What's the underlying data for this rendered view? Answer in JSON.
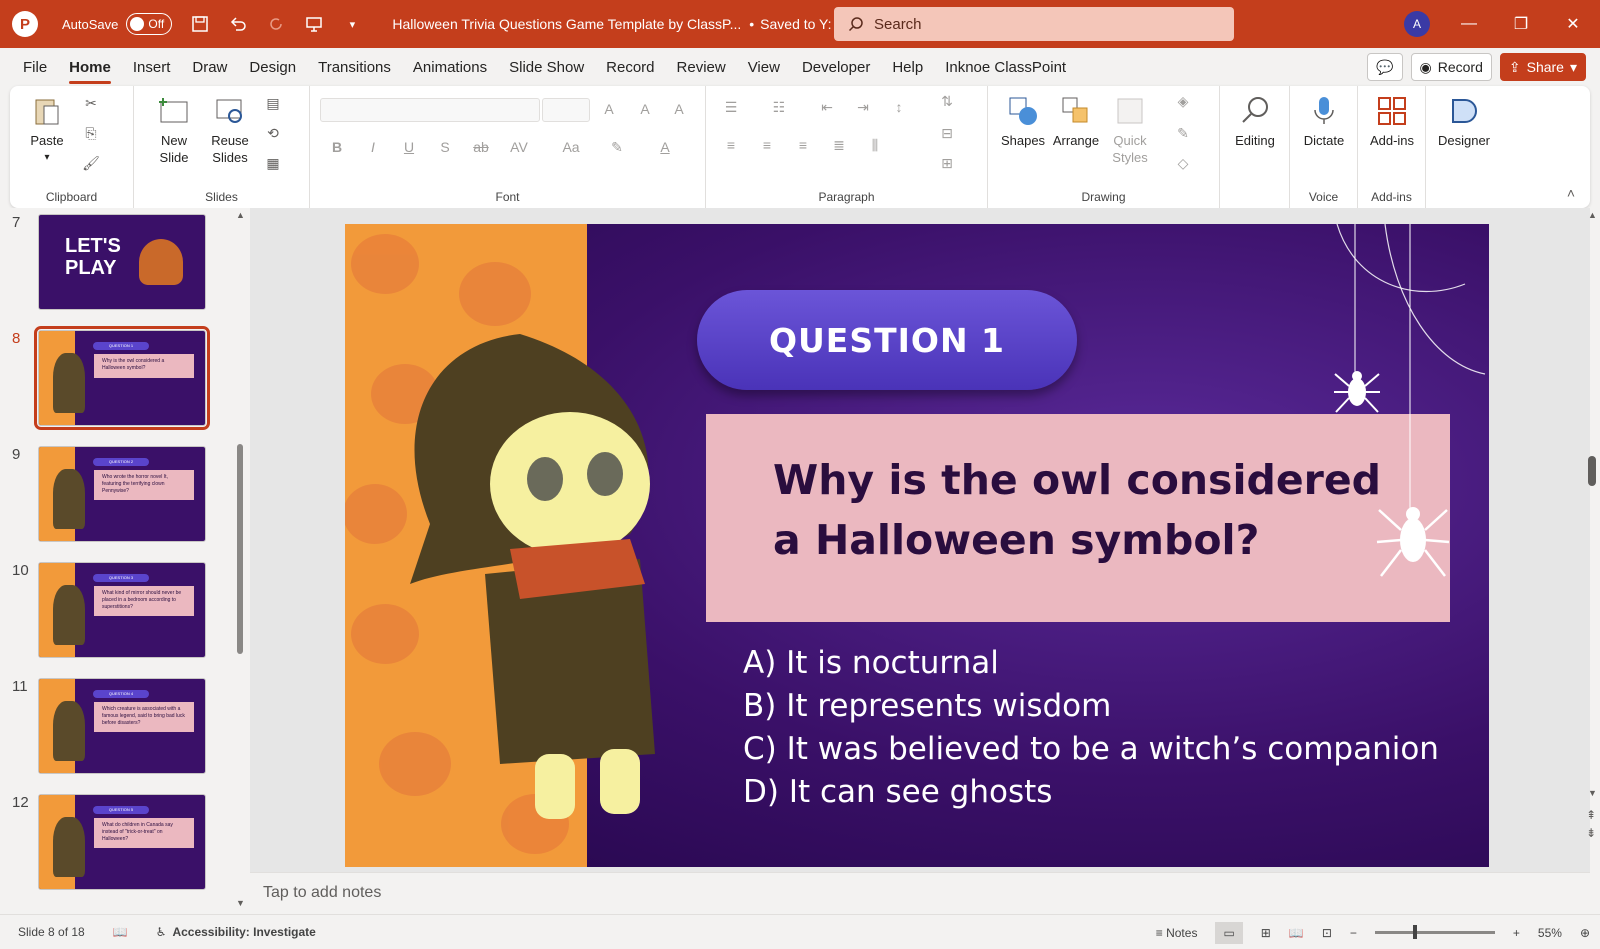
{
  "titlebar": {
    "autosave_label": "AutoSave",
    "autosave_state": "Off",
    "doc_title": "Halloween Trivia Questions Game Template by ClassP...",
    "saved_status": "Saved to Y: Drive",
    "search_placeholder": "Search",
    "avatar_initial": "A",
    "accent_color": "#c43e1c"
  },
  "menu": {
    "items": [
      "File",
      "Home",
      "Insert",
      "Draw",
      "Design",
      "Transitions",
      "Animations",
      "Slide Show",
      "Record",
      "Review",
      "View",
      "Developer",
      "Help",
      "Inknoe ClassPoint"
    ],
    "active": "Home",
    "record_label": "Record",
    "share_label": "Share"
  },
  "ribbon": {
    "clipboard": {
      "paste": "Paste",
      "label": "Clipboard"
    },
    "slides": {
      "new_slide": "New Slide",
      "reuse_slides": "Reuse Slides",
      "label": "Slides"
    },
    "font": {
      "label": "Font"
    },
    "paragraph": {
      "label": "Paragraph"
    },
    "drawing": {
      "shapes": "Shapes",
      "arrange": "Arrange",
      "quick_styles": "Quick Styles",
      "label": "Drawing"
    },
    "editing": {
      "label": "Editing"
    },
    "voice": {
      "dictate": "Dictate",
      "label": "Voice"
    },
    "addins": {
      "addins": "Add-ins",
      "label": "Add-ins"
    },
    "designer": {
      "label": "Designer"
    }
  },
  "thumbnails": [
    {
      "num": "7",
      "title": "LET'S PLAY"
    },
    {
      "num": "8",
      "question": "QUESTION 1",
      "text": "Why is the owl considered a Halloween symbol?"
    },
    {
      "num": "9",
      "question": "QUESTION 2",
      "text": "Who wrote the horror novel It, featuring the terrifying clown Pennywise?"
    },
    {
      "num": "10",
      "question": "QUESTION 3",
      "text": "What kind of mirror should never be placed in a bedroom according to superstitions?"
    },
    {
      "num": "11",
      "question": "QUESTION 4",
      "text": "Which creature is associated with a famous legend, said to bring bad luck before disasters?"
    },
    {
      "num": "12",
      "question": "QUESTION 5",
      "text": "What do children in Canada say instead of \"trick-or-treat\" on Halloween?"
    }
  ],
  "slide": {
    "question_label": "QUESTION 1",
    "question_text": "Why is the owl considered a Halloween symbol?",
    "answers": [
      "A) It is nocturnal",
      "B) It represents wisdom",
      "C) It was believed to be a witch’s companion",
      "D) It can see ghosts"
    ]
  },
  "notes_placeholder": "Tap to add notes",
  "status": {
    "slide_counter": "Slide 8 of 18",
    "accessibility": "Accessibility: Investigate",
    "notes_label": "Notes",
    "zoom": "55%"
  }
}
